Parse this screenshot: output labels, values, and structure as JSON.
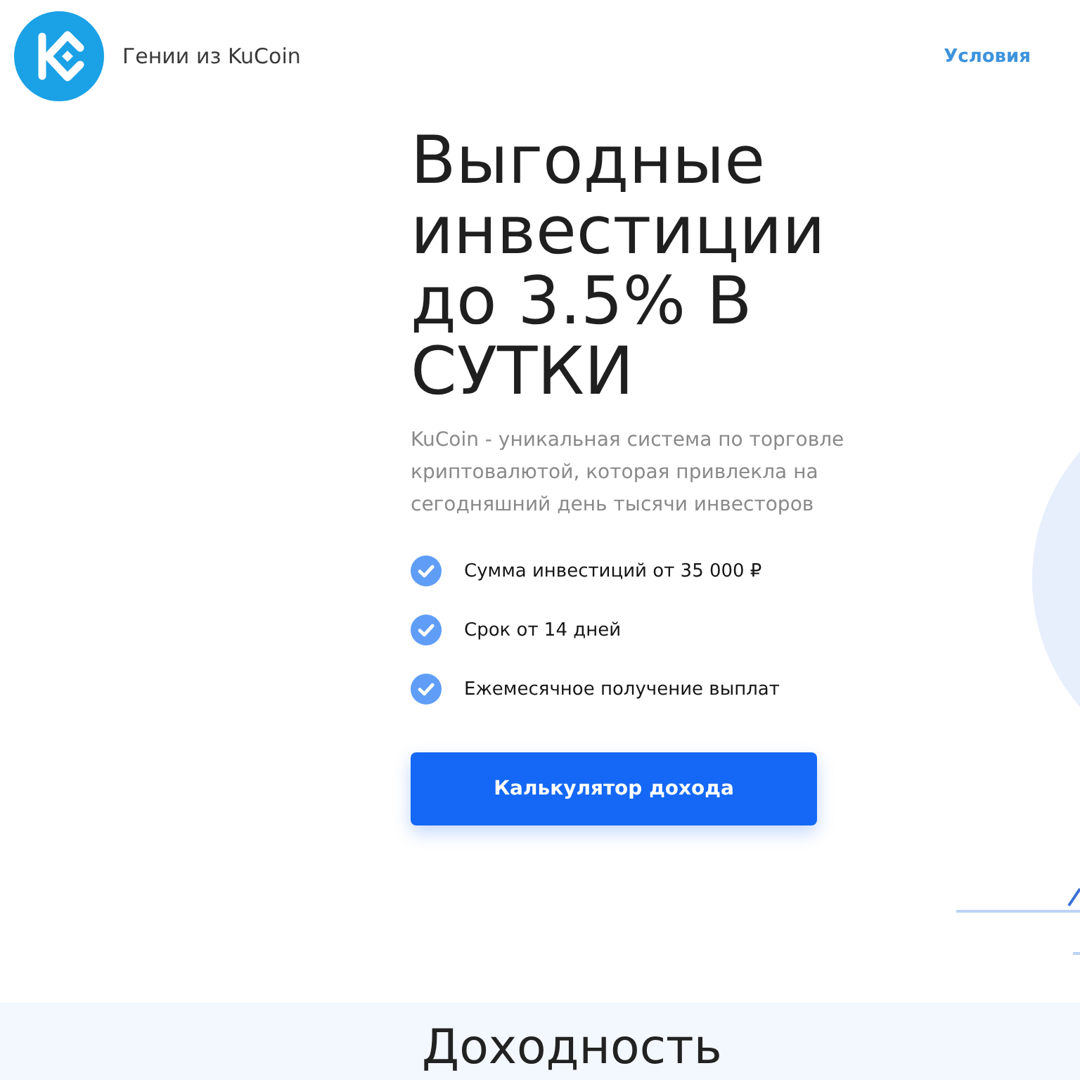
{
  "header": {
    "site_name": "Гении из KuCoin",
    "nav_link": "Условия"
  },
  "hero": {
    "title": "Выгодные инвестиции до 3.5% В СУТКИ",
    "description": "KuCoin - уникальная система по торговле криптовалютой, которая привлекла на сегодняшний день тысячи инвесторов",
    "features": [
      "Сумма инвестиций от 35 000 ₽",
      "Срок от 14 дней",
      "Ежемесячное получение выплат"
    ],
    "button": "Калькулятор дохода"
  },
  "next_section": {
    "title": "Доходность"
  }
}
